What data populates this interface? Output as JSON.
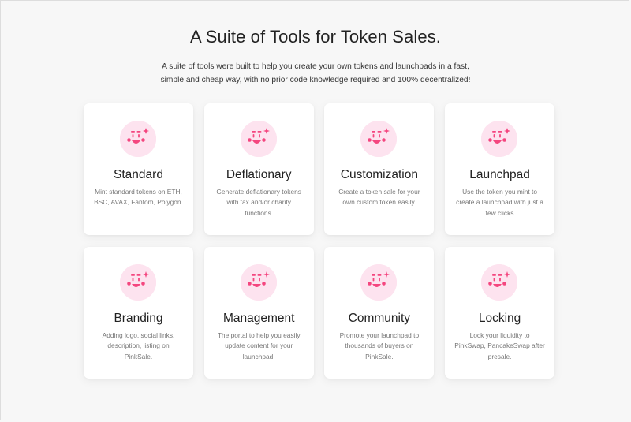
{
  "section": {
    "title": "A Suite of Tools for Token Sales.",
    "subtitle": "A suite of tools were built to help you create your own tokens and launchpads in a fast, simple and cheap way, with no prior code knowledge required and 100% decentralized!"
  },
  "colors": {
    "accent": "#f4467f",
    "icon_bg": "#fde3ef"
  },
  "features": [
    {
      "icon": "smiley-sparkle-icon",
      "title": "Standard",
      "description": "Mint standard tokens on ETH, BSC, AVAX, Fantom, Polygon."
    },
    {
      "icon": "smiley-sparkle-icon",
      "title": "Deflationary",
      "description": "Generate deflationary tokens with tax and/or charity functions."
    },
    {
      "icon": "smiley-sparkle-icon",
      "title": "Customization",
      "description": "Create a token sale for your own custom token easily."
    },
    {
      "icon": "smiley-sparkle-icon",
      "title": "Launchpad",
      "description": "Use the token you mint to create a launchpad with just a few clicks"
    },
    {
      "icon": "smiley-sparkle-icon",
      "title": "Branding",
      "description": "Adding logo, social links, description, listing on PinkSale."
    },
    {
      "icon": "smiley-sparkle-icon",
      "title": "Management",
      "description": "The portal to help you easily update content for your launchpad."
    },
    {
      "icon": "smiley-sparkle-icon",
      "title": "Community",
      "description": "Promote your launchpad to thousands of buyers on PinkSale."
    },
    {
      "icon": "smiley-sparkle-icon",
      "title": "Locking",
      "description": "Lock your liquidity to PinkSwap, PancakeSwap after presale."
    }
  ]
}
